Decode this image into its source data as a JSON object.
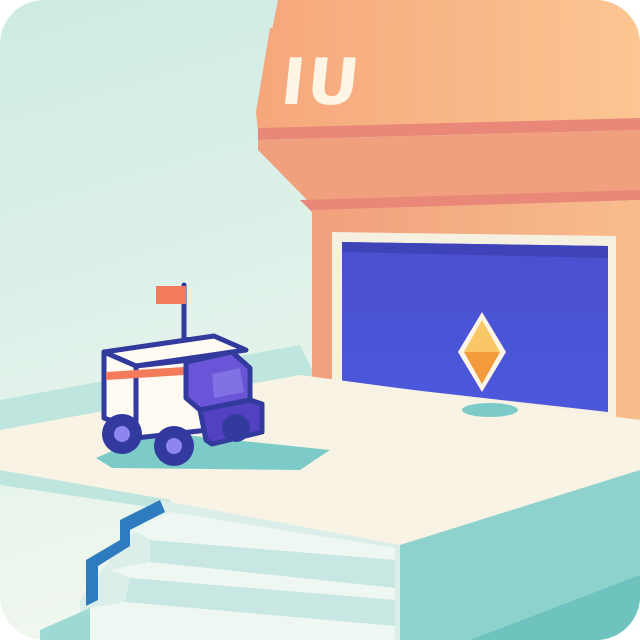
{
  "building": {
    "sign_text": "IU"
  },
  "colors": {
    "sky": "#d7efe8",
    "sky_light": "#eef8f2",
    "building_light": "#f7b98a",
    "building_main": "#f0a47c",
    "building_stripe": "#e98878",
    "door": "#4a52d6",
    "door_frame": "#f5f0e2",
    "floor": "#f8f3e6",
    "teal": "#8fd3cf",
    "teal_dark": "#5fbdb9",
    "rover_navy": "#323a9e",
    "rover_purple": "#6a55d8",
    "flag": "#f47a5c",
    "crystal": "#f6a94b"
  },
  "icons": {
    "rover": "delivery-rover-icon",
    "flag": "flag-icon",
    "crystal": "diamond-crystal-icon"
  }
}
